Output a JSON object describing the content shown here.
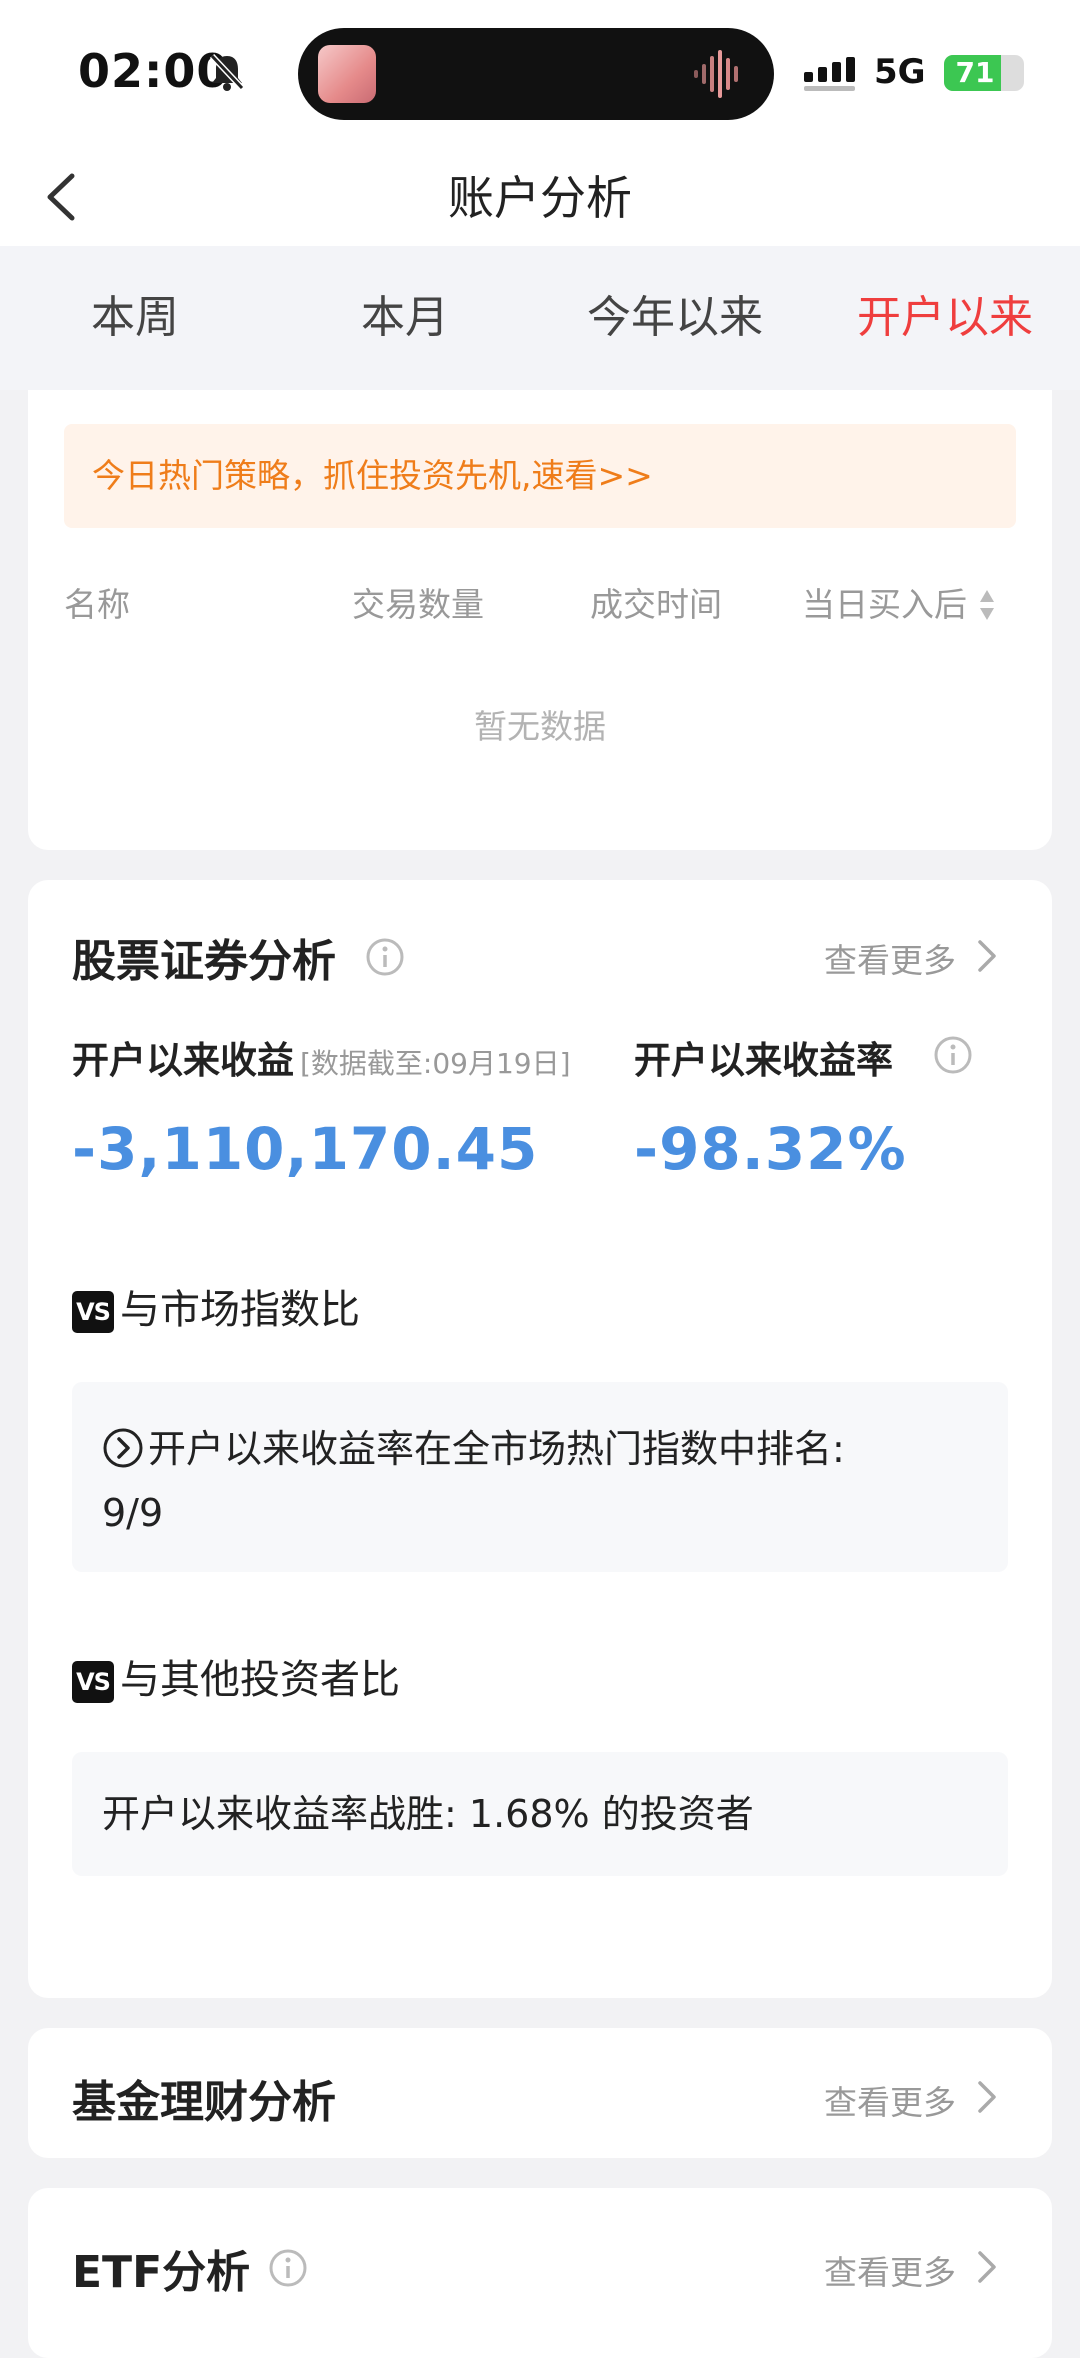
{
  "status_bar": {
    "time": "02:00",
    "network": "5G",
    "battery": "71",
    "battery_level": 0.71,
    "battery_color": "#3cc752",
    "icons": [
      "bell-muted-icon",
      "signal-icon",
      "battery-icon"
    ]
  },
  "nav": {
    "title": "账户分析",
    "back_icon": "chevron-left-icon"
  },
  "tabs": [
    {
      "label": "本周",
      "active": false
    },
    {
      "label": "本月",
      "active": false
    },
    {
      "label": "今年以来",
      "active": false
    },
    {
      "label": "开户以来",
      "active": true
    }
  ],
  "trade_card": {
    "banner_text": "今日热门策略，抓住投资先机,速看>>",
    "columns": [
      "名称",
      "交易数量",
      "成交时间",
      "当日买入后"
    ],
    "empty_text": "暂无数据"
  },
  "stock_analysis": {
    "title": "股票证券分析",
    "more": "查看更多",
    "profit_label": "开户以来收益",
    "profit_note": "[数据截至:09月19日]",
    "profit_value": "-3,110,170.45",
    "rate_label": "开户以来收益率",
    "rate_value": "-98.32%",
    "vs_badge": "VS",
    "market_title": "与市场指数比",
    "market_text": "开户以来收益率在全市场热门指数中排名:",
    "market_rank": "9/9",
    "investor_title": "与其他投资者比",
    "investor_prefix": "开户以来收益率战胜: ",
    "investor_value": "1.68%",
    "investor_suffix": " 的投资者"
  },
  "fund_analysis": {
    "title": "基金理财分析",
    "more": "查看更多"
  },
  "etf_analysis": {
    "title": "ETF分析",
    "more": "查看更多"
  },
  "colors": {
    "accent_red": "#ef3e3e",
    "value_blue": "#4a8fe0",
    "banner_orange": "#ef7d1a"
  }
}
